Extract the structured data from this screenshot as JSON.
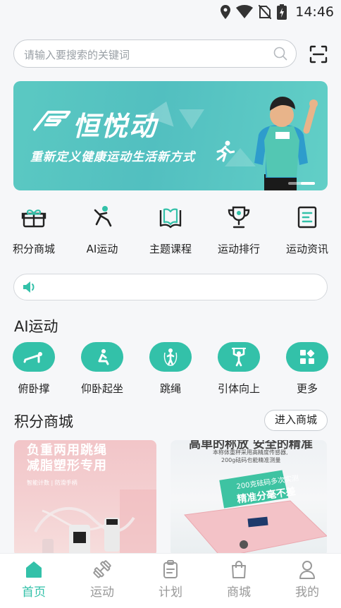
{
  "status_bar": {
    "time": "14:46",
    "icons": [
      "location-icon",
      "wifi-icon",
      "no-sim-icon",
      "battery-charging-icon"
    ]
  },
  "search": {
    "placeholder": "请输入要搜索的关键词",
    "scan_icon": "scan-icon"
  },
  "banner": {
    "brand": "恒悦动",
    "slogan": "重新定义健康运动生活新方式",
    "slide_index": 2,
    "slide_count": 2
  },
  "quick_menu": [
    {
      "label": "积分商城",
      "icon": "gift-icon"
    },
    {
      "label": "AI运动",
      "icon": "running-person-icon"
    },
    {
      "label": "主题课程",
      "icon": "book-icon"
    },
    {
      "label": "运动排行",
      "icon": "trophy-icon"
    },
    {
      "label": "运动资讯",
      "icon": "news-icon"
    }
  ],
  "notice": {
    "icon": "speaker-icon",
    "text": ""
  },
  "ai_section": {
    "title": "AI运动",
    "items": [
      {
        "label": "俯卧撑",
        "icon": "pushup-icon"
      },
      {
        "label": "仰卧起坐",
        "icon": "situp-icon"
      },
      {
        "label": "跳绳",
        "icon": "jump-rope-icon"
      },
      {
        "label": "引体向上",
        "icon": "pullup-icon"
      },
      {
        "label": "更多",
        "icon": "grid-more-icon"
      }
    ]
  },
  "mall_section": {
    "title": "积分商城",
    "enter_label": "进入商城",
    "products": [
      {
        "headline_1": "负重两用跳绳",
        "headline_2": "减脂塑形专用",
        "subline": "智能计数 | 防滑手柄"
      },
      {
        "headline": "高单的称放  安全的精准",
        "desc_1": "本称体重秤采用高精度传感器,",
        "desc_2": "200g砝码也能精准测量",
        "badge_1": "200克砝码多次实测",
        "badge_2": "精准分毫不差"
      }
    ]
  },
  "tab_bar": [
    {
      "label": "首页",
      "icon": "home-icon",
      "active": true
    },
    {
      "label": "运动",
      "icon": "dumbbell-icon",
      "active": false
    },
    {
      "label": "计划",
      "icon": "clipboard-icon",
      "active": false
    },
    {
      "label": "商城",
      "icon": "shopping-bag-icon",
      "active": false
    },
    {
      "label": "我的",
      "icon": "person-icon",
      "active": false
    }
  ],
  "colors": {
    "accent": "#33c1a9",
    "banner": "#5bc9c2",
    "inactive": "#999999"
  }
}
